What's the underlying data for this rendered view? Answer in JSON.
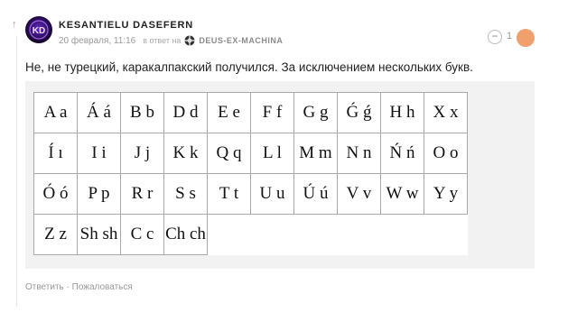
{
  "comment": {
    "author": "KESANTIELU DASEFERN",
    "timestamp": "20 февраля, 11:16",
    "reply_to_label": "в ответ на",
    "reply_to_user": "DEUS-EX-MACHINA",
    "vote_count": "1",
    "text": "Не, не турецкий, каракалпакский получился. За исключением нескольких букв.",
    "alphabet_rows": [
      [
        "A a",
        "Á á",
        "B b",
        "D d",
        "E e",
        "F f",
        "G g",
        "Ǵ ǵ",
        "H h",
        "X x"
      ],
      [
        "Í ı",
        "I i",
        "J j",
        "K k",
        "Q q",
        "L l",
        "M m",
        "N n",
        "Ń ń",
        "O o"
      ],
      [
        "Ó ó",
        "P p",
        "R r",
        "S s",
        "T t",
        "U u",
        "Ú ú",
        "V v",
        "W w",
        "Y y"
      ],
      [
        "Z z",
        "Sh sh",
        "C c",
        "Ch ch"
      ]
    ],
    "actions": {
      "reply": "Ответить",
      "separator": " · ",
      "report": "Пожаловаться"
    }
  },
  "icons": {
    "collapse": "up-arrow-icon",
    "avatar": "user-avatar",
    "reply_user_avatar": "deus-ex-machina-avatar-icon"
  },
  "colors": {
    "vote_plus": "#f0a06c",
    "meta_text": "#999999"
  }
}
